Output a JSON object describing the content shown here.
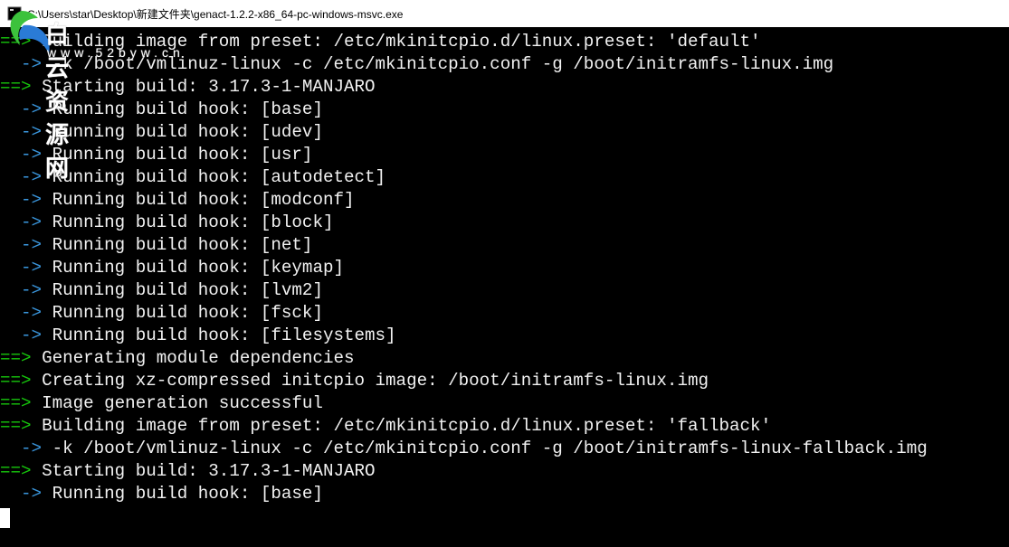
{
  "titlebar": {
    "path": "C:\\Users\\star\\Desktop\\新建文件夹\\genact-1.2.2-x86_64-pc-windows-msvc.exe"
  },
  "watermark": {
    "cn": "白云资源网",
    "url": "www.52byw.cn"
  },
  "prefixes": {
    "double": "==> ",
    "single": "  -> "
  },
  "hooks1": [
    "base",
    "udev",
    "usr",
    "autodetect",
    "modconf",
    "block",
    "net",
    "keymap",
    "lvm2",
    "fsck",
    "filesystems"
  ],
  "hooks2": [
    "base"
  ],
  "msgs": {
    "build_default_a": "Building image from preset: /etc/mkinitcpio.d/linux.preset: ",
    "build_default_b": "'default'",
    "kline_default": "-k /boot/vmlinuz-linux -c /etc/mkinitcpio.conf -g /boot/initramfs-linux.img",
    "starting_build": "Starting build: 3.17.3-1-MANJARO",
    "hook_prefix": "Running build hook: ",
    "gen_deps": "Generating module dependencies",
    "create_img": "Creating xz-compressed initcpio image: /boot/initramfs-linux.img",
    "img_success": "Image generation successful",
    "build_fallback_a": "Building image from preset: /etc/mkinitcpio.d/linux.preset: ",
    "build_fallback_b": "'fallback'",
    "kline_fallback": "-k /boot/vmlinuz-linux -c /etc/mkinitcpio.conf -g /boot/initramfs-linux-fallback.img"
  }
}
